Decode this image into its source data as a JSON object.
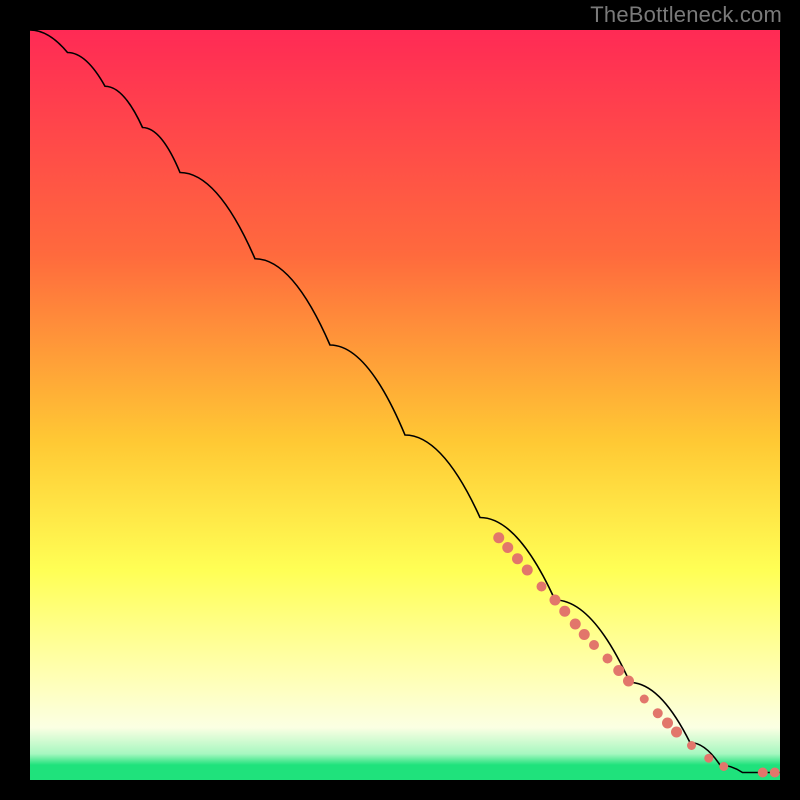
{
  "watermark": "TheBottleneck.com",
  "colors": {
    "background": "#000000",
    "watermark_text": "#7a7a7a",
    "curve": "#000000",
    "marker": "#e2766b",
    "green_band": "#1fe27c"
  },
  "chart_data": {
    "type": "line",
    "title": "",
    "xlabel": "",
    "ylabel": "",
    "xlim": [
      0,
      100
    ],
    "ylim": [
      0,
      100
    ],
    "gradient_stops": [
      {
        "offset": 0,
        "color": "#ff2a55"
      },
      {
        "offset": 30,
        "color": "#ff6a3d"
      },
      {
        "offset": 55,
        "color": "#ffc934"
      },
      {
        "offset": 72,
        "color": "#ffff55"
      },
      {
        "offset": 86,
        "color": "#ffffb3"
      },
      {
        "offset": 93,
        "color": "#fbffe3"
      },
      {
        "offset": 96.5,
        "color": "#a7f7c0"
      },
      {
        "offset": 98,
        "color": "#1fe27c"
      },
      {
        "offset": 100,
        "color": "#1fe27c"
      }
    ],
    "curve": [
      {
        "x": 0,
        "y": 100
      },
      {
        "x": 5,
        "y": 97
      },
      {
        "x": 10,
        "y": 92.5
      },
      {
        "x": 15,
        "y": 87
      },
      {
        "x": 20,
        "y": 81
      },
      {
        "x": 30,
        "y": 69.5
      },
      {
        "x": 40,
        "y": 58
      },
      {
        "x": 50,
        "y": 46
      },
      {
        "x": 60,
        "y": 35
      },
      {
        "x": 70,
        "y": 24
      },
      {
        "x": 80,
        "y": 13
      },
      {
        "x": 88,
        "y": 5
      },
      {
        "x": 92,
        "y": 2
      },
      {
        "x": 95,
        "y": 1
      },
      {
        "x": 100,
        "y": 1
      }
    ],
    "markers": [
      {
        "x": 62.5,
        "y": 32.3,
        "r": 5.5
      },
      {
        "x": 63.7,
        "y": 31.0,
        "r": 5.5
      },
      {
        "x": 65.0,
        "y": 29.5,
        "r": 5.5
      },
      {
        "x": 66.3,
        "y": 28.0,
        "r": 5.5
      },
      {
        "x": 68.2,
        "y": 25.8,
        "r": 5.0
      },
      {
        "x": 70.0,
        "y": 24.0,
        "r": 5.5
      },
      {
        "x": 71.3,
        "y": 22.5,
        "r": 5.5
      },
      {
        "x": 72.7,
        "y": 20.8,
        "r": 5.5
      },
      {
        "x": 73.9,
        "y": 19.4,
        "r": 5.5
      },
      {
        "x": 75.2,
        "y": 18.0,
        "r": 5.0
      },
      {
        "x": 77.0,
        "y": 16.2,
        "r": 5.0
      },
      {
        "x": 78.5,
        "y": 14.6,
        "r": 5.5
      },
      {
        "x": 79.8,
        "y": 13.2,
        "r": 5.5
      },
      {
        "x": 81.9,
        "y": 10.8,
        "r": 4.5
      },
      {
        "x": 83.7,
        "y": 8.9,
        "r": 5.0
      },
      {
        "x": 85.0,
        "y": 7.6,
        "r": 5.5
      },
      {
        "x": 86.2,
        "y": 6.4,
        "r": 5.5
      },
      {
        "x": 88.2,
        "y": 4.6,
        "r": 4.5
      },
      {
        "x": 90.5,
        "y": 2.9,
        "r": 4.5
      },
      {
        "x": 92.5,
        "y": 1.8,
        "r": 4.5
      },
      {
        "x": 97.7,
        "y": 1.0,
        "r": 5.0
      },
      {
        "x": 99.3,
        "y": 1.0,
        "r": 5.0
      }
    ]
  }
}
